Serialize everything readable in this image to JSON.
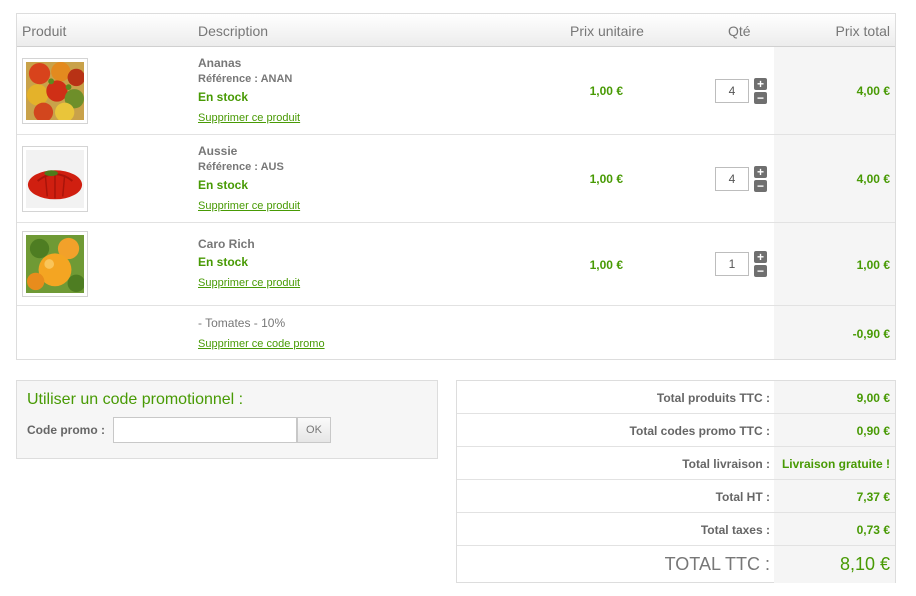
{
  "colors": {
    "accent": "#489a04",
    "text": "#666666",
    "border": "#dddddd",
    "total_bg": "#f5f5f5"
  },
  "table": {
    "headers": {
      "product": "Produit",
      "description": "Description",
      "unit_price": "Prix unitaire",
      "quantity": "Qté",
      "total_price": "Prix total"
    },
    "items": [
      {
        "name": "Ananas",
        "reference": "Référence : ANAN",
        "stock": "En stock",
        "remove_label": "Supprimer ce produit",
        "unit_price": "1,00 €",
        "quantity": "4",
        "total": "4,00 €",
        "thumbnail_icon": "multicolor-tomatoes-photo"
      },
      {
        "name": "Aussie",
        "reference": "Référence : AUS",
        "stock": "En stock",
        "remove_label": "Supprimer ce produit",
        "unit_price": "1,00 €",
        "quantity": "4",
        "total": "4,00 €",
        "thumbnail_icon": "red-ribbed-tomato-photo"
      },
      {
        "name": "Caro Rich",
        "stock": "En stock",
        "remove_label": "Supprimer ce produit",
        "unit_price": "1,00 €",
        "quantity": "1",
        "total": "1,00 €",
        "thumbnail_icon": "orange-tomatoes-photo"
      }
    ],
    "discount": {
      "label": "- Tomates - 10%",
      "remove_label": "Supprimer ce code promo",
      "amount": "-0,90 €"
    }
  },
  "promo": {
    "title": "Utiliser un code promotionnel :",
    "field_label": "Code promo :",
    "input_value": "",
    "button_label": "OK"
  },
  "totals": [
    {
      "label": "Total produits TTC :",
      "value": "9,00 €"
    },
    {
      "label": "Total codes promo TTC :",
      "value": "0,90 €"
    },
    {
      "label": "Total livraison :",
      "value": "Livraison gratuite !"
    },
    {
      "label": "Total HT :",
      "value": "7,37 €"
    },
    {
      "label": "Total taxes :",
      "value": "0,73 €"
    },
    {
      "label": "TOTAL TTC :",
      "value": "8,10 €"
    }
  ]
}
